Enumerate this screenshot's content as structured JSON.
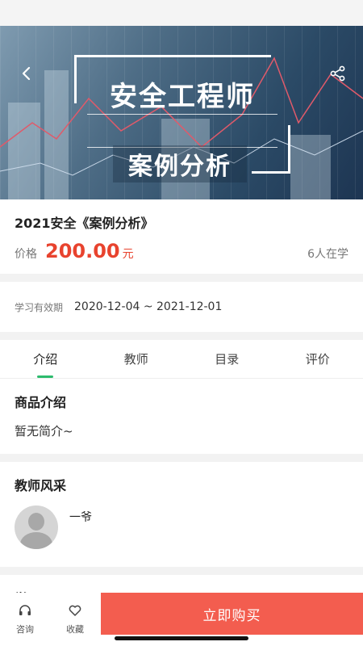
{
  "banner": {
    "title_main": "安全工程师",
    "title_sub": "案例分析",
    "back_icon": "chevron-left-icon",
    "share_icon": "share-icon"
  },
  "course": {
    "title": "2021安全《案例分析》",
    "price_label": "价格",
    "price_value": "200.00",
    "price_unit": "元",
    "learners": "6人在学"
  },
  "validity": {
    "label": "学习有效期",
    "value": "2020-12-04 ~ 2021-12-01"
  },
  "tabs": [
    {
      "label": "介绍",
      "active": true
    },
    {
      "label": "教师",
      "active": false
    },
    {
      "label": "目录",
      "active": false
    },
    {
      "label": "评价",
      "active": false
    }
  ],
  "intro": {
    "title": "商品介绍",
    "text": "暂无简介~"
  },
  "teachers": {
    "title": "教师风采",
    "items": [
      {
        "name": "一爷"
      }
    ]
  },
  "catalog": {
    "title": "学习目录"
  },
  "bottom_bar": {
    "consult_label": "咨询",
    "favorite_label": "收藏",
    "buy_label": "立即购买"
  },
  "colors": {
    "accent_red": "#e8432e",
    "buy_button": "#f35d4f",
    "tab_indicator": "#2dbb6d"
  }
}
